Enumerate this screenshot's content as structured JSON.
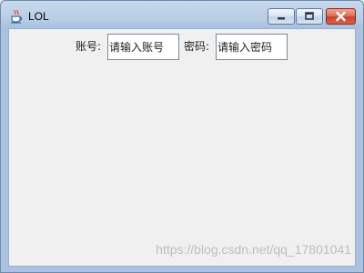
{
  "window": {
    "title": "LOL",
    "icon": "java-coffee-cup-icon"
  },
  "controls": {
    "minimize_icon": "minimize-icon",
    "maximize_icon": "maximize-icon",
    "close_icon": "close-icon"
  },
  "form": {
    "account_label": "账号:",
    "account_placeholder": "请输入账号",
    "password_label": "密码:",
    "password_placeholder": "请输入密码"
  },
  "watermark": "https://blog.csdn.net/qq_17801041",
  "colors": {
    "client_background": "#f0f0f0",
    "close_button": "#c9432c"
  }
}
